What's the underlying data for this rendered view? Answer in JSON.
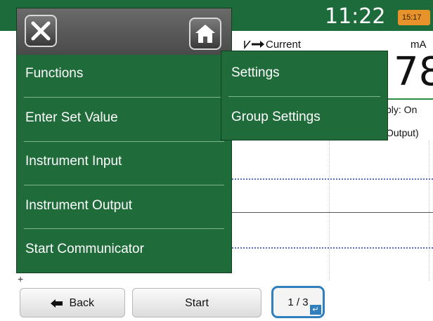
{
  "status_bar": {
    "time": "11:22",
    "badge": "15:17"
  },
  "display": {
    "measurement_label": "Current",
    "unit": "mA",
    "value": "78",
    "supply_text": "ply: On",
    "output_text": "Output)"
  },
  "menu": {
    "items": [
      {
        "label": "Functions"
      },
      {
        "label": "Enter Set Value"
      },
      {
        "label": "Instrument Input"
      },
      {
        "label": "Instrument Output"
      },
      {
        "label": "Start Communicator"
      }
    ]
  },
  "submenu": {
    "items": [
      {
        "label": "Settings"
      },
      {
        "label": "Group Settings"
      }
    ]
  },
  "bottom_bar": {
    "back_label": "Back",
    "start_label": "Start",
    "page_label": "1 / 3"
  },
  "icons": [
    "close-icon",
    "home-icon",
    "arrow-left-icon",
    "enter-icon",
    "current-arrow-icon"
  ],
  "colors": {
    "menu_green": "#1f6b3a",
    "header_green": "#1d6b3a",
    "accent_blue": "#2f7fbf",
    "badge_orange": "#e8922b"
  }
}
